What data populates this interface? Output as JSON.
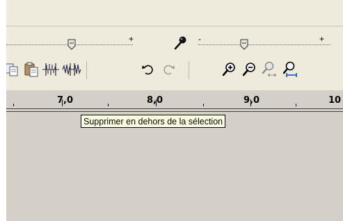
{
  "ruler": {
    "labels": [
      "7,0",
      "8,0",
      "9,0",
      "10"
    ]
  },
  "slider_left": {
    "plus": "+"
  },
  "slider_right": {
    "minus": "-",
    "plus": "+"
  },
  "tooltip": {
    "text": "Supprimer en dehors de la sélection"
  },
  "icons": {
    "mic": "microphone-icon",
    "copy": "copy-icon",
    "paste": "paste-icon",
    "trim": "trim-outside-selection-icon",
    "silence": "silence-selection-icon",
    "undo": "undo-icon",
    "redo": "redo-icon",
    "zoom_in": "zoom-in-icon",
    "zoom_out": "zoom-out-icon",
    "fit_selection": "fit-selection-icon",
    "fit_project": "fit-project-icon"
  },
  "colors": {
    "toolbar_bg": "#eeeadc",
    "workspace_bg": "#d4d0c8",
    "tooltip_bg": "#ffffe1"
  }
}
